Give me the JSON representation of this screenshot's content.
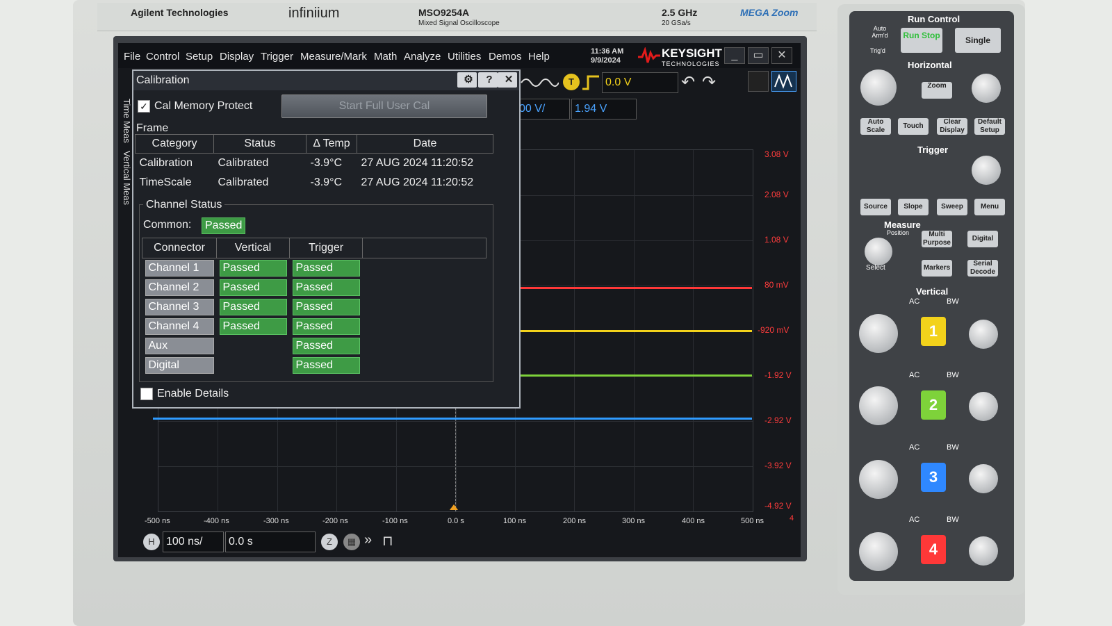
{
  "instrument": {
    "maker": "Agilent Technologies",
    "series": "infiniium",
    "model": "MSO9254A",
    "model_desc": "Mixed Signal Oscilloscope",
    "bandwidth": "2.5 GHz",
    "sample_rate": "20 GSa/s",
    "megazoom": "MEGA Zoom"
  },
  "menubar": {
    "items": [
      "File",
      "Control",
      "Setup",
      "Display",
      "Trigger",
      "Measure/Mark",
      "Math",
      "Analyze",
      "Utilities",
      "Demos",
      "Help"
    ],
    "time": "11:36 AM",
    "date": "9/9/2024",
    "vendor": "KEYSIGHT",
    "vendor_sub": "TECHNOLOGIES"
  },
  "toolbar": {
    "trigger_level": "0.0 V",
    "ch_scale": "00 V/",
    "ch_offset": "1.94 V"
  },
  "side_tabs": [
    "Time Meas",
    "Vertical Meas"
  ],
  "dialog": {
    "title": "Calibration",
    "cal_memory_protect": "Cal Memory Protect",
    "start_button": "Start Full User Cal",
    "frame_label": "Frame",
    "frame_columns": [
      "Category",
      "Status",
      "Δ Temp",
      "Date"
    ],
    "frame_rows": [
      [
        "Calibration",
        "Calibrated",
        "-3.9°C",
        "27 AUG 2024 11:20:52"
      ],
      [
        "TimeScale",
        "Calibrated",
        "-3.9°C",
        "27 AUG 2024 11:20:52"
      ]
    ],
    "channel_status_label": "Channel Status",
    "common_label": "Common:",
    "common_value": "Passed",
    "conn_columns": [
      "Connector",
      "Vertical",
      "Trigger"
    ],
    "conn_rows": [
      [
        "Channel 1",
        "Passed",
        "Passed"
      ],
      [
        "Channel 2",
        "Passed",
        "Passed"
      ],
      [
        "Channel 3",
        "Passed",
        "Passed"
      ],
      [
        "Channel 4",
        "Passed",
        "Passed"
      ],
      [
        "Aux",
        "",
        "Passed"
      ],
      [
        "Digital",
        "",
        "Passed"
      ]
    ],
    "enable_details": "Enable Details"
  },
  "volt_labels": [
    "3.08 V",
    "2.08 V",
    "1.08 V",
    "80 mV",
    "-920 mV",
    "-1.92 V",
    "-2.92 V",
    "-3.92 V",
    "-4.92 V"
  ],
  "time_labels": [
    "-500 ns",
    "-400 ns",
    "-300 ns",
    "-200 ns",
    "-100 ns",
    "0.0 s",
    "100 ns",
    "200 ns",
    "300 ns",
    "400 ns",
    "500 ns"
  ],
  "channel_marker": "4",
  "bottom": {
    "h_label": "H",
    "timebase": "100 ns/",
    "delay": "0.0 s"
  },
  "panel": {
    "run_control": "Run Control",
    "auto_armd": "Auto Arm'd",
    "trigd": "Trig'd",
    "run_stop": "Run Stop",
    "single": "Single",
    "horizontal": "Horizontal",
    "zoom": "Zoom",
    "auto_scale": "Auto Scale",
    "touch": "Touch",
    "clear_display": "Clear Display",
    "default_setup": "Default Setup",
    "trigger": "Trigger",
    "source": "Source",
    "slope": "Slope",
    "sweep": "Sweep",
    "menu": "Menu",
    "measure": "Measure",
    "position": "Position",
    "multi_purpose": "Multi Purpose",
    "digital": "Digital",
    "select": "Select",
    "markers": "Markers",
    "serial_decode": "Serial Decode",
    "vertical": "Vertical",
    "ac": "AC",
    "bw": "BW",
    "ch1": "1",
    "ch2": "2",
    "ch3": "3",
    "ch4": "4"
  },
  "colors": {
    "ch1": "#f3d21b",
    "ch2": "#7ed23a",
    "ch3": "#2f88ff",
    "ch4": "#ff3838",
    "passed": "#3e9b45"
  }
}
